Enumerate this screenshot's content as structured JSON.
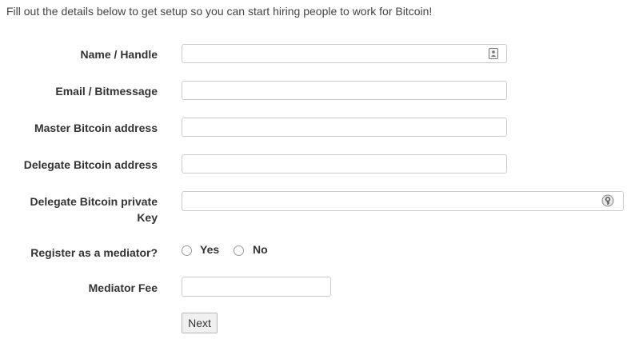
{
  "intro": "Fill out the details below to get setup so you can start hiring people to work for Bitcoin!",
  "fields": {
    "name": {
      "label": "Name / Handle",
      "value": ""
    },
    "email": {
      "label": "Email / Bitmessage",
      "value": ""
    },
    "master_address": {
      "label": "Master Bitcoin address",
      "value": ""
    },
    "delegate_address": {
      "label": "Delegate Bitcoin address",
      "value": ""
    },
    "delegate_key": {
      "label_line1": "Delegate Bitcoin private",
      "label_line2": "Key",
      "value": ""
    },
    "mediator": {
      "label": "Register as a mediator?",
      "options": [
        "Yes",
        "No"
      ],
      "selected": null
    },
    "mediator_fee": {
      "label": "Mediator Fee",
      "value": ""
    }
  },
  "next_button": "Next",
  "icons": {
    "name_field": "contact-card-icon",
    "key_field": "key-icon"
  }
}
